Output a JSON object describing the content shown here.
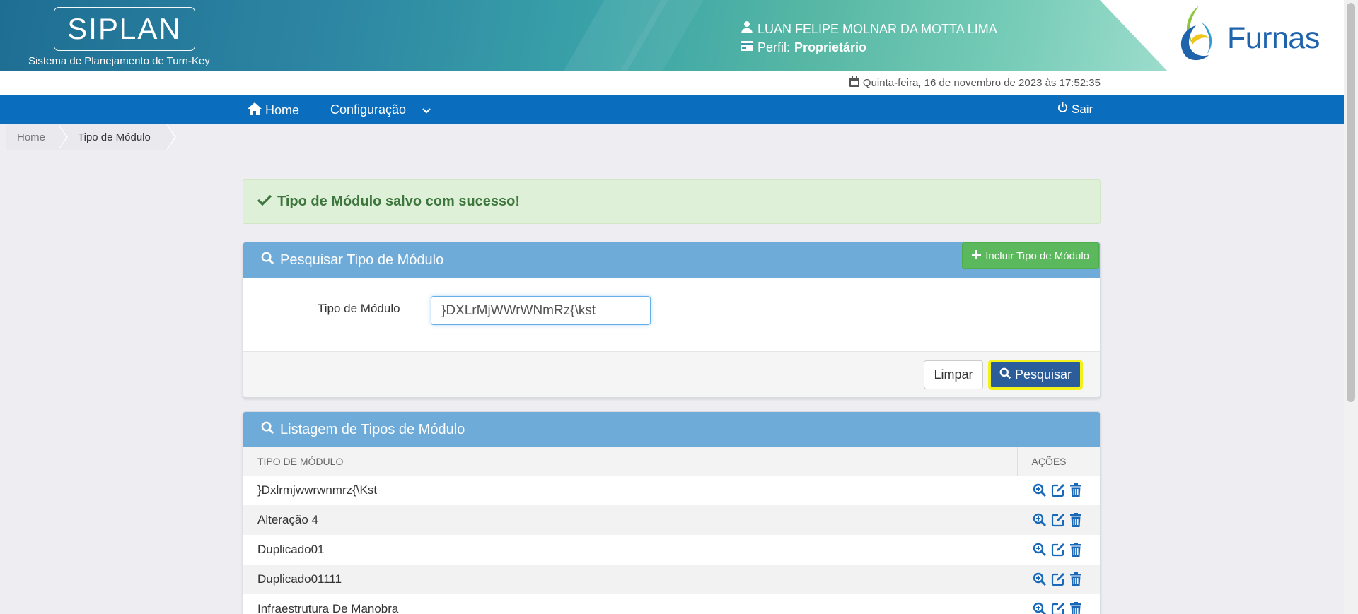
{
  "header": {
    "logo_title": "SIPLAN",
    "logo_subtitle": "Sistema de Planejamento de Turn-Key",
    "user_name": "LUAN FELIPE MOLNAR DA MOTTA LIMA",
    "profile_label": "Perfil:",
    "profile_value": "Proprietário",
    "brand": "Furnas"
  },
  "datetime": "Quinta-feira, 16 de novembro de 2023 às 17:52:35",
  "nav": {
    "home": "Home",
    "config": "Configuração",
    "logout": "Sair"
  },
  "breadcrumb": [
    "Home",
    "Tipo de Módulo"
  ],
  "alert": {
    "message": "Tipo de Módulo salvo com sucesso!"
  },
  "search": {
    "title": "Pesquisar Tipo de Módulo",
    "add_button": "Incluir Tipo de Módulo",
    "field_label": "Tipo de Módulo",
    "field_value": "}DXLrMjWWrWNmRz{\\kst",
    "clear_button": "Limpar",
    "search_button": "Pesquisar"
  },
  "list": {
    "title": "Listagem de Tipos de Módulo",
    "columns": [
      "TIPO DE MÓDULO",
      "AÇÕES"
    ],
    "rows": [
      "}Dxlrmjwwrwnmrz{\\Kst",
      "Alteração 4",
      "Duplicado01",
      "Duplicado01111",
      "Infraestrutura De Manobra"
    ]
  },
  "colors": {
    "nav": "#0a6dbe",
    "panel_head": "#6fabd9",
    "success": "#5cb85c",
    "primary": "#2a5d9a",
    "highlight": "#f2f21a",
    "brand": "#1f63ad"
  }
}
